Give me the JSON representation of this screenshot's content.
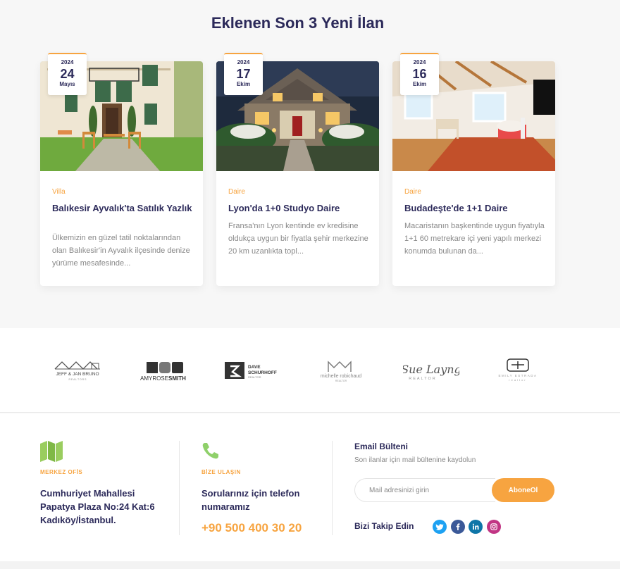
{
  "section": {
    "title": "Eklenen Son 3 Yeni İlan"
  },
  "listings": [
    {
      "year": "2024",
      "day": "24",
      "month": "Mayıs",
      "category": "Villa",
      "title": "Balıkesir Ayvalık'ta Satılık Yazlık",
      "desc": "Ülkemizin en güzel tatil noktalarından olan Balıkesir'in Ayvalık ilçesinde denize yürüme mesafesinde..."
    },
    {
      "year": "2024",
      "day": "17",
      "month": "Ekim",
      "category": "Daire",
      "title": "Lyon'da 1+0 Studyo Daire",
      "desc": "Fransa'nın Lyon kentinde ev kredisine oldukça uygun bir fiyatla şehir merkezine 20 km uzanlıkta topl..."
    },
    {
      "year": "2024",
      "day": "16",
      "month": "Ekim",
      "category": "Daire",
      "title": "Budadeşte'de 1+1 Daire",
      "desc": "Macaristanın başkentinde uygun fiyatıyla 1+1 60 metrekare içi yeni yapılı merkezi konumda bulunan da..."
    }
  ],
  "brands": {
    "b1_line1": "JEFF & JAN BRUNO",
    "b1_line2": "R E A L T O R S",
    "b2_a": "AMYROSE",
    "b2_b": "SMITH",
    "b3_line1": "DAVE",
    "b3_line2": "SCHURHOFF",
    "b3_line3": "REALTOR",
    "b4_line1": "michelle robichaud",
    "b4_line2": "REALTOR",
    "b5_line1": "Sue Layng",
    "b5_line2": "REALTOR",
    "b6_line1": "EMILY ESTRADA",
    "b6_line2": "realtor"
  },
  "footer": {
    "office_label": "MERKEZ OFİS",
    "office_address_1": "Cumhuriyet Mahallesi",
    "office_address_2": "Papatya Plaza No:24 Kat:6",
    "office_address_3": "Kadıköy/İstanbul.",
    "contact_label": "BİZE ULAŞIN",
    "contact_text_1": "Sorularınız için telefon",
    "contact_text_2": "numaramız",
    "phone": "+90 500 400 30 20",
    "newsletter_title": "Email Bülteni",
    "newsletter_sub": "Son ilanlar için mail bültenine kaydolun",
    "email_placeholder": "Mail adresinizi girin",
    "subscribe_label": "AboneOl",
    "follow_label": "Bizi Takip Edin",
    "social": [
      "twitter",
      "facebook",
      "linkedin",
      "instagram"
    ]
  },
  "colors": {
    "accent": "#f7a440",
    "heading": "#2c2a5a",
    "twitter": "#1da1f2",
    "facebook": "#3b5998",
    "linkedin": "#0e76a8",
    "instagram": "#c13584"
  }
}
